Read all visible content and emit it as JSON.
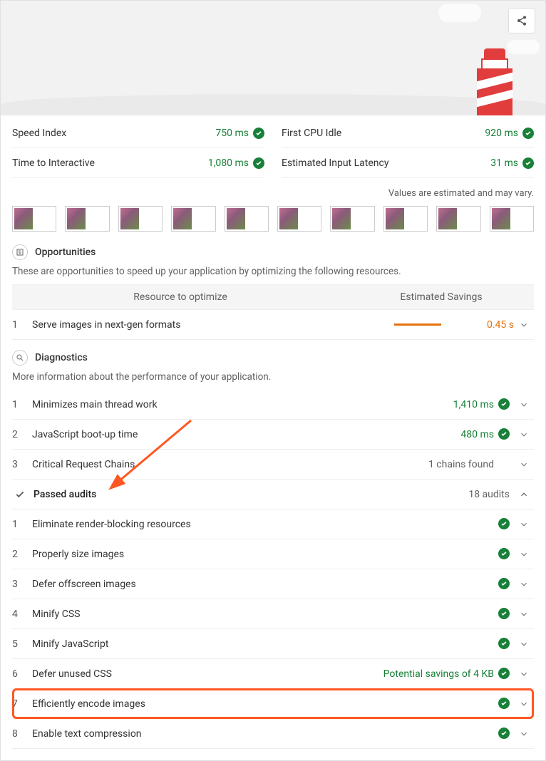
{
  "metrics": {
    "left": [
      {
        "label": "Speed Index",
        "value": "750 ms"
      },
      {
        "label": "Time to Interactive",
        "value": "1,080 ms"
      }
    ],
    "right": [
      {
        "label": "First CPU Idle",
        "value": "920 ms"
      },
      {
        "label": "Estimated Input Latency",
        "value": "31 ms"
      }
    ],
    "note": "Values are estimated and may vary."
  },
  "opportunities": {
    "title": "Opportunities",
    "desc": "These are opportunities to speed up your application by optimizing the following resources.",
    "col1": "Resource to optimize",
    "col2": "Estimated Savings",
    "rows": [
      {
        "n": "1",
        "title": "Serve images in next-gen formats",
        "savings": "0.45 s",
        "bar_pct": 55
      }
    ]
  },
  "diagnostics": {
    "title": "Diagnostics",
    "desc": "More information about the performance of your application.",
    "rows": [
      {
        "n": "1",
        "title": "Minimizes main thread work",
        "value": "1,410 ms",
        "kind": "pass"
      },
      {
        "n": "2",
        "title": "JavaScript boot-up time",
        "value": "480 ms",
        "kind": "pass"
      },
      {
        "n": "3",
        "title": "Critical Request Chains",
        "value": "1 chains found",
        "kind": "info"
      }
    ]
  },
  "passed": {
    "title": "Passed audits",
    "count": "18 audits",
    "rows": [
      {
        "n": "1",
        "title": "Eliminate render-blocking resources",
        "value": ""
      },
      {
        "n": "2",
        "title": "Properly size images",
        "value": ""
      },
      {
        "n": "3",
        "title": "Defer offscreen images",
        "value": ""
      },
      {
        "n": "4",
        "title": "Minify CSS",
        "value": ""
      },
      {
        "n": "5",
        "title": "Minify JavaScript",
        "value": ""
      },
      {
        "n": "6",
        "title": "Defer unused CSS",
        "value": "Potential savings of 4 KB"
      },
      {
        "n": "7",
        "title": "Efficiently encode images",
        "value": ""
      },
      {
        "n": "8",
        "title": "Enable text compression",
        "value": ""
      }
    ]
  },
  "annotations": {
    "highlighted_row": 7
  }
}
